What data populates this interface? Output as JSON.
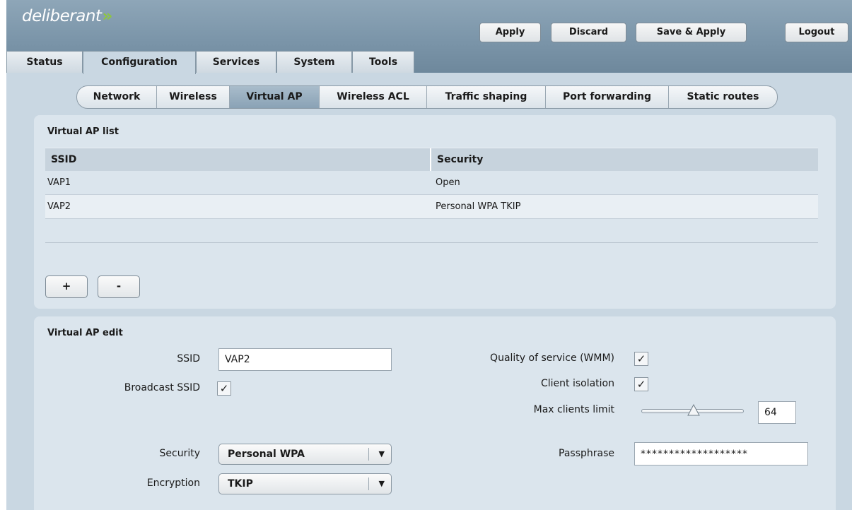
{
  "header": {
    "logo_text": "deliberant",
    "logo_arrows": "»",
    "buttons": {
      "apply": "Apply",
      "discard": "Discard",
      "save_apply": "Save & Apply",
      "logout": "Logout"
    }
  },
  "main_tabs": [
    {
      "label": "Status"
    },
    {
      "label": "Configuration",
      "active": true
    },
    {
      "label": "Services"
    },
    {
      "label": "System"
    },
    {
      "label": "Tools"
    }
  ],
  "sub_tabs": [
    {
      "label": "Network"
    },
    {
      "label": "Wireless"
    },
    {
      "label": "Virtual AP",
      "active": true
    },
    {
      "label": "Wireless ACL"
    },
    {
      "label": "Traffic shaping"
    },
    {
      "label": "Port forwarding"
    },
    {
      "label": "Static routes"
    }
  ],
  "vap_list": {
    "title": "Virtual AP list",
    "columns": {
      "ssid": "SSID",
      "security": "Security"
    },
    "rows": [
      {
        "ssid": "VAP1",
        "security": "Open"
      },
      {
        "ssid": "VAP2",
        "security": "Personal WPA TKIP"
      }
    ],
    "add_label": "+",
    "remove_label": "-"
  },
  "vap_edit": {
    "title": "Virtual AP edit",
    "ssid_label": "SSID",
    "ssid_value": "VAP2",
    "broadcast_label": "Broadcast SSID",
    "broadcast_checked": true,
    "security_label": "Security",
    "security_value": "Personal WPA",
    "encryption_label": "Encryption",
    "encryption_value": "TKIP",
    "qos_label": "Quality of service (WMM)",
    "qos_checked": true,
    "isolation_label": "Client isolation",
    "isolation_checked": true,
    "max_clients_label": "Max clients limit",
    "max_clients_value": "64",
    "passphrase_label": "Passphrase",
    "passphrase_value": "*******************"
  },
  "icons": {
    "check": "checkmark-icon",
    "dropdown": "triangle-down-icon",
    "slider": "slider-thumb-icon"
  },
  "colors": {
    "accent_green": "#8ec641",
    "header_blue": "#7b95a9",
    "panel_bg": "#dbe5ed"
  },
  "glyphs": {
    "check": "✓",
    "dropdown": "▼"
  }
}
